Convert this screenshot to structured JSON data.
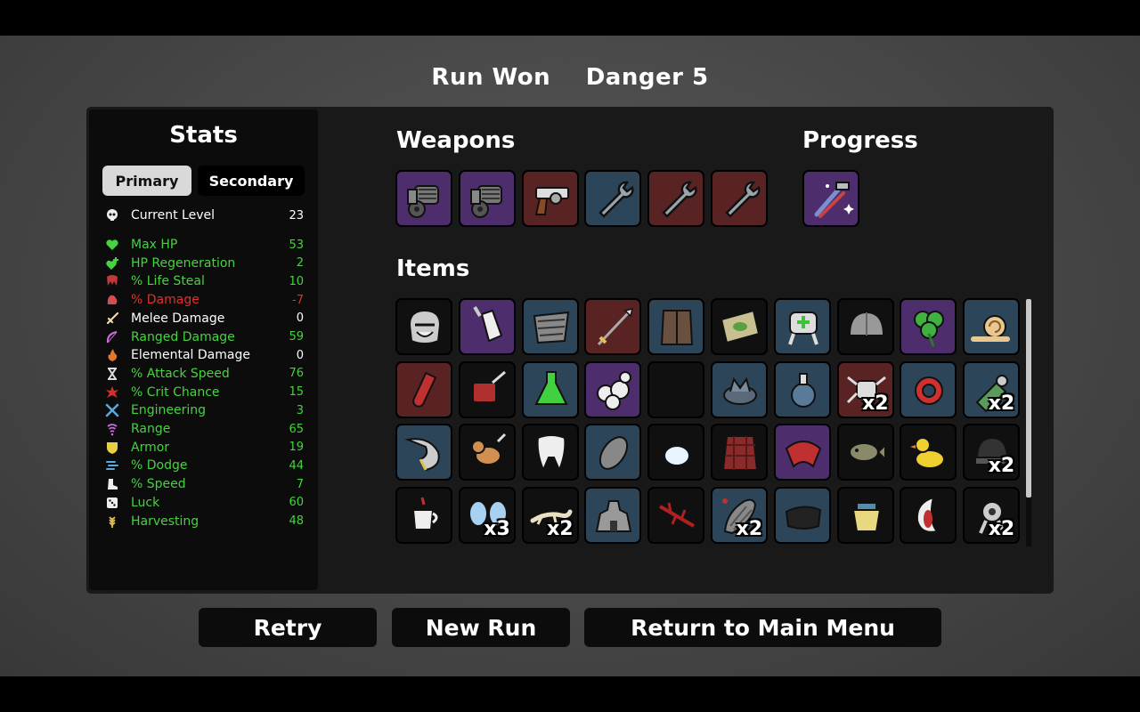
{
  "header": {
    "status": "Run Won",
    "danger": "Danger 5"
  },
  "stats": {
    "title": "Stats",
    "tabs": {
      "primary": "Primary",
      "secondary": "Secondary"
    },
    "level": {
      "label": "Current Level",
      "value": "23",
      "icon": "skull-level-icon"
    },
    "items": [
      {
        "label": "Max HP",
        "value": "53",
        "color": "#46d33f",
        "icon": "heart-icon"
      },
      {
        "label": "HP Regeneration",
        "value": "2",
        "color": "#46d33f",
        "icon": "heart-plus-icon"
      },
      {
        "label": "% Life Steal",
        "value": "10",
        "color": "#46d33f",
        "icon": "fangs-icon"
      },
      {
        "label": "% Damage",
        "value": "-7",
        "color": "#e03030",
        "icon": "muscle-icon"
      },
      {
        "label": "Melee Damage",
        "value": "0",
        "color": "#ffffff",
        "icon": "sword-icon"
      },
      {
        "label": "Ranged Damage",
        "value": "59",
        "color": "#46d33f",
        "icon": "bow-icon"
      },
      {
        "label": "Elemental Damage",
        "value": "0",
        "color": "#ffffff",
        "icon": "flame-icon"
      },
      {
        "label": "% Attack Speed",
        "value": "76",
        "color": "#46d33f",
        "icon": "hourglass-icon"
      },
      {
        "label": "% Crit Chance",
        "value": "15",
        "color": "#46d33f",
        "icon": "crit-burst-icon"
      },
      {
        "label": "Engineering",
        "value": "3",
        "color": "#46d33f",
        "icon": "crossed-wrench-icon"
      },
      {
        "label": "Range",
        "value": "65",
        "color": "#46d33f",
        "icon": "range-wave-icon"
      },
      {
        "label": "Armor",
        "value": "19",
        "color": "#46d33f",
        "icon": "shield-icon"
      },
      {
        "label": "% Dodge",
        "value": "44",
        "color": "#46d33f",
        "icon": "dodge-icon"
      },
      {
        "label": "% Speed",
        "value": "7",
        "color": "#46d33f",
        "icon": "boot-icon"
      },
      {
        "label": "Luck",
        "value": "60",
        "color": "#46d33f",
        "icon": "dice-icon"
      },
      {
        "label": "Harvesting",
        "value": "48",
        "color": "#46d33f",
        "icon": "wheat-icon"
      }
    ]
  },
  "weapons": {
    "title": "Weapons",
    "list": [
      {
        "icon": "minigun-icon",
        "tier": 3
      },
      {
        "icon": "minigun-icon",
        "tier": 3
      },
      {
        "icon": "revolver-icon",
        "tier": 4
      },
      {
        "icon": "wrench-icon",
        "tier": 2
      },
      {
        "icon": "wrench-icon",
        "tier": 4
      },
      {
        "icon": "wrench-icon",
        "tier": 4
      }
    ]
  },
  "progress": {
    "title": "Progress",
    "list": [
      {
        "icon": "tools-sparkle-icon",
        "tier": 3
      }
    ]
  },
  "items": {
    "title": "Items",
    "list": [
      {
        "icon": "knight-helmet-icon",
        "tier": 1,
        "count": ""
      },
      {
        "icon": "baby-bottle-icon",
        "tier": 3,
        "count": ""
      },
      {
        "icon": "torn-armor-icon",
        "tier": 2,
        "count": ""
      },
      {
        "icon": "spear-icon",
        "tier": 4,
        "count": ""
      },
      {
        "icon": "leather-vest-icon",
        "tier": 2,
        "count": ""
      },
      {
        "icon": "banknote-icon",
        "tier": 1,
        "count": ""
      },
      {
        "icon": "medic-robot-icon",
        "tier": 2,
        "count": ""
      },
      {
        "icon": "steel-helmet-icon",
        "tier": 1,
        "count": ""
      },
      {
        "icon": "clover-icon",
        "tier": 3,
        "count": ""
      },
      {
        "icon": "snail-icon",
        "tier": 2,
        "count": ""
      },
      {
        "icon": "blood-vial-icon",
        "tier": 4,
        "count": ""
      },
      {
        "icon": "meat-cleaver-icon",
        "tier": 1,
        "count": ""
      },
      {
        "icon": "flask-icon",
        "tier": 2,
        "count": ""
      },
      {
        "icon": "mushroom-cluster-icon",
        "tier": 3,
        "count": ""
      },
      {
        "icon": "crescent-icon",
        "tier": 1,
        "count": ""
      },
      {
        "icon": "stone-crown-icon",
        "tier": 2,
        "count": ""
      },
      {
        "icon": "potion-icon",
        "tier": 2,
        "count": ""
      },
      {
        "icon": "spider-icon",
        "tier": 4,
        "count": "x2"
      },
      {
        "icon": "red-ring-icon",
        "tier": 2,
        "count": ""
      },
      {
        "icon": "grenade-icon",
        "tier": 2,
        "count": "x2"
      },
      {
        "icon": "horn-icon",
        "tier": 2,
        "count": ""
      },
      {
        "icon": "dog-icon",
        "tier": 1,
        "count": ""
      },
      {
        "icon": "tooth-icon",
        "tier": 1,
        "count": ""
      },
      {
        "icon": "cocoon-icon",
        "tier": 2,
        "count": ""
      },
      {
        "icon": "snowball-icon",
        "tier": 1,
        "count": ""
      },
      {
        "icon": "plaid-shirt-icon",
        "tier": 1,
        "count": ""
      },
      {
        "icon": "bandana-icon",
        "tier": 3,
        "count": ""
      },
      {
        "icon": "fish-icon",
        "tier": 1,
        "count": ""
      },
      {
        "icon": "duck-icon",
        "tier": 1,
        "count": ""
      },
      {
        "icon": "beanie-icon",
        "tier": 1,
        "count": "x2"
      },
      {
        "icon": "coffee-cup-icon",
        "tier": 1,
        "count": ""
      },
      {
        "icon": "butterfly-icon",
        "tier": 1,
        "count": "x3"
      },
      {
        "icon": "lizard-icon",
        "tier": 1,
        "count": "x2"
      },
      {
        "icon": "rock-castle-icon",
        "tier": 2,
        "count": ""
      },
      {
        "icon": "thorn-branch-icon",
        "tier": 1,
        "count": ""
      },
      {
        "icon": "leech-icon",
        "tier": 2,
        "count": "x2"
      },
      {
        "icon": "black-cloth-icon",
        "tier": 2,
        "count": ""
      },
      {
        "icon": "pot-icon",
        "tier": 1,
        "count": ""
      },
      {
        "icon": "screaming-mouth-icon",
        "tier": 1,
        "count": ""
      },
      {
        "icon": "turret-icon",
        "tier": 1,
        "count": "x2"
      }
    ]
  },
  "buttons": {
    "retry": "Retry",
    "new_run": "New Run",
    "main_menu": "Return to Main Menu"
  }
}
